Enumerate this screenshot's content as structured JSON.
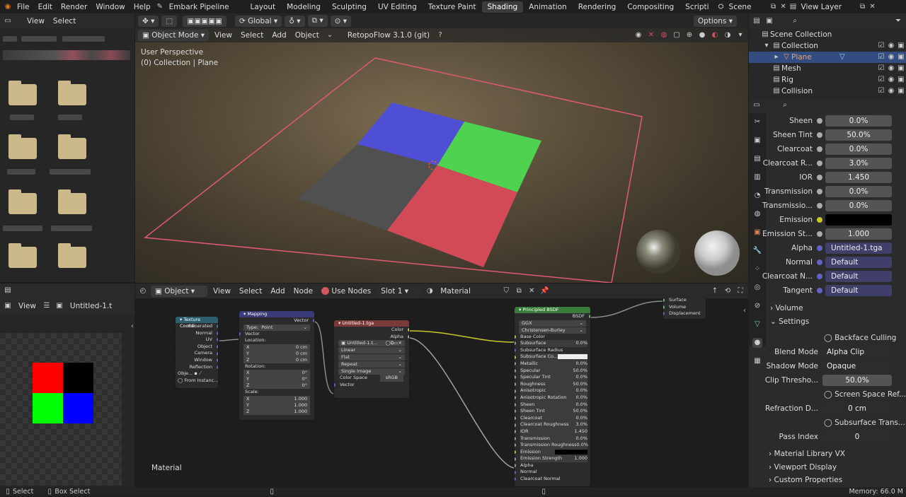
{
  "menu": {
    "file": "File",
    "edit": "Edit",
    "render": "Render",
    "window": "Window",
    "help": "Help",
    "pipeline": "Embark Pipeline"
  },
  "workspaces": [
    "Layout",
    "Modeling",
    "Sculpting",
    "UV Editing",
    "Texture Paint",
    "Shading",
    "Animation",
    "Rendering",
    "Compositing",
    "Scripti"
  ],
  "scene": "Scene",
  "view_layer": "View Layer",
  "filebrowser": {
    "view": "View",
    "select": "Select"
  },
  "toolbar": {
    "orientation": "Global",
    "options": "Options"
  },
  "viewport": {
    "mode": "Object Mode",
    "view": "View",
    "select": "Select",
    "add": "Add",
    "object": "Object",
    "addon": "RetopoFlow 3.1.0 (git)",
    "perspective": "User Perspective",
    "context": "(0) Collection | Plane",
    "colors": {
      "blue": "#4f4fd6",
      "green": "#4fd24f",
      "red": "#d24a57",
      "gray": "#505050",
      "outline": "#e05a72"
    }
  },
  "outliner": {
    "scene_collection": "Scene Collection",
    "collection": "Collection",
    "items": [
      "Plane",
      "Mesh",
      "Rig",
      "Collision"
    ]
  },
  "properties": [
    {
      "label": "Sheen",
      "value": "0.0%",
      "kind": "num"
    },
    {
      "label": "Sheen Tint",
      "value": "50.0%",
      "kind": "num"
    },
    {
      "label": "Clearcoat",
      "value": "0.0%",
      "kind": "num"
    },
    {
      "label": "Clearcoat R...",
      "value": "3.0%",
      "kind": "num"
    },
    {
      "label": "IOR",
      "value": "1.450",
      "kind": "num"
    },
    {
      "label": "Transmission",
      "value": "0.0%",
      "kind": "num"
    },
    {
      "label": "Transmissio...",
      "value": "0.0%",
      "kind": "num"
    },
    {
      "label": "Emission",
      "value": "",
      "kind": "color"
    },
    {
      "label": "Emission St...",
      "value": "1.000",
      "kind": "num"
    },
    {
      "label": "Alpha",
      "value": "Untitled-1.tga",
      "kind": "link"
    },
    {
      "label": "Normal",
      "value": "Default",
      "kind": "link"
    },
    {
      "label": "Clearcoat N...",
      "value": "Default",
      "kind": "link"
    },
    {
      "label": "Tangent",
      "value": "Default",
      "kind": "link"
    }
  ],
  "panels": {
    "volume": "Volume",
    "settings": "Settings",
    "backface": "Backface Culling",
    "blend_mode_label": "Blend Mode",
    "blend_mode": "Alpha Clip",
    "shadow_mode_label": "Shadow Mode",
    "shadow_mode": "Opaque",
    "clip_label": "Clip Thresho...",
    "clip": "50.0%",
    "ssr": "Screen Space Ref...",
    "refraction_label": "Refraction D...",
    "refraction": "0 cm",
    "subsurface": "Subsurface Trans...",
    "pass_label": "Pass Index",
    "pass": "0",
    "matlib": "Material Library VX",
    "viewport_display": "Viewport Display",
    "custom_props": "Custom Properties"
  },
  "image_editor": {
    "view": "View",
    "image": "Untitled-1.t"
  },
  "node_editor": {
    "object": "Object",
    "view": "View",
    "select": "Select",
    "add": "Add",
    "node": "Node",
    "use_nodes": "Use Nodes",
    "slot": "Slot 1",
    "material": "Material",
    "footer_label": "Material"
  },
  "nodes": {
    "texcoord": {
      "title": "Texture Coordi...",
      "rows": [
        "Generated",
        "Normal",
        "UV",
        "Object",
        "Camera",
        "Window",
        "Reflection"
      ],
      "obj": "Obje...",
      "from": "From Instanc..."
    },
    "mapping": {
      "title": "Mapping",
      "out": "Vector",
      "type_label": "Type:",
      "type": "Point",
      "in": "Vector",
      "loc": "Location:",
      "rot": "Rotation:",
      "scale": "Scale:",
      "axes": [
        "X",
        "Y",
        "Z"
      ],
      "loc_vals": [
        "0 cm",
        "0 cm",
        "0 cm"
      ],
      "rot_vals": [
        "0°",
        "0°",
        "0°"
      ],
      "scale_vals": [
        "1.000",
        "1.000",
        "1.000"
      ]
    },
    "image": {
      "title": "Untitled-1.tga",
      "out_color": "Color",
      "out_alpha": "Alpha",
      "file": "Untitled-1.t...",
      "interp": "Linear",
      "proj": "Flat",
      "ext": "Repeat",
      "source": "Single Image",
      "cs_label": "Color Space",
      "cs": "sRGB",
      "in": "Vector"
    },
    "bsdf": {
      "title": "Principled BSDF",
      "out": "BSDF",
      "dist": "GGX",
      "sss": "Christensen-Burley",
      "rows": [
        [
          "Base Color",
          ""
        ],
        [
          "Subsurface",
          "0.0%"
        ],
        [
          "Subsurface Radius",
          ""
        ],
        [
          "Subsurface Co...",
          ""
        ],
        [
          "Metallic",
          "0.0%"
        ],
        [
          "Specular",
          "50.0%"
        ],
        [
          "Specular Tint",
          "0.0%"
        ],
        [
          "Roughness",
          "50.0%"
        ],
        [
          "Anisotropic",
          "0.0%"
        ],
        [
          "Anisotropic Rotation",
          "0.0%"
        ],
        [
          "Sheen",
          "0.0%"
        ],
        [
          "Sheen Tint",
          "50.0%"
        ],
        [
          "Clearcoat",
          "0.0%"
        ],
        [
          "Clearcoat Roughness",
          "3.0%"
        ],
        [
          "IOR",
          "1.450"
        ],
        [
          "Transmission",
          "0.0%"
        ],
        [
          "Transmission Roughness",
          "0.0%"
        ],
        [
          "Emission",
          ""
        ],
        [
          "Emission Strength",
          "1.000"
        ],
        [
          "Alpha",
          ""
        ],
        [
          "Normal",
          ""
        ],
        [
          "Clearcoat Normal",
          ""
        ]
      ]
    },
    "output": {
      "rows": [
        "Surface",
        "Volume",
        "Displacement"
      ]
    }
  },
  "status": {
    "select": "Select",
    "box": "Box Select",
    "memory": "Memory: 66.0 M"
  }
}
